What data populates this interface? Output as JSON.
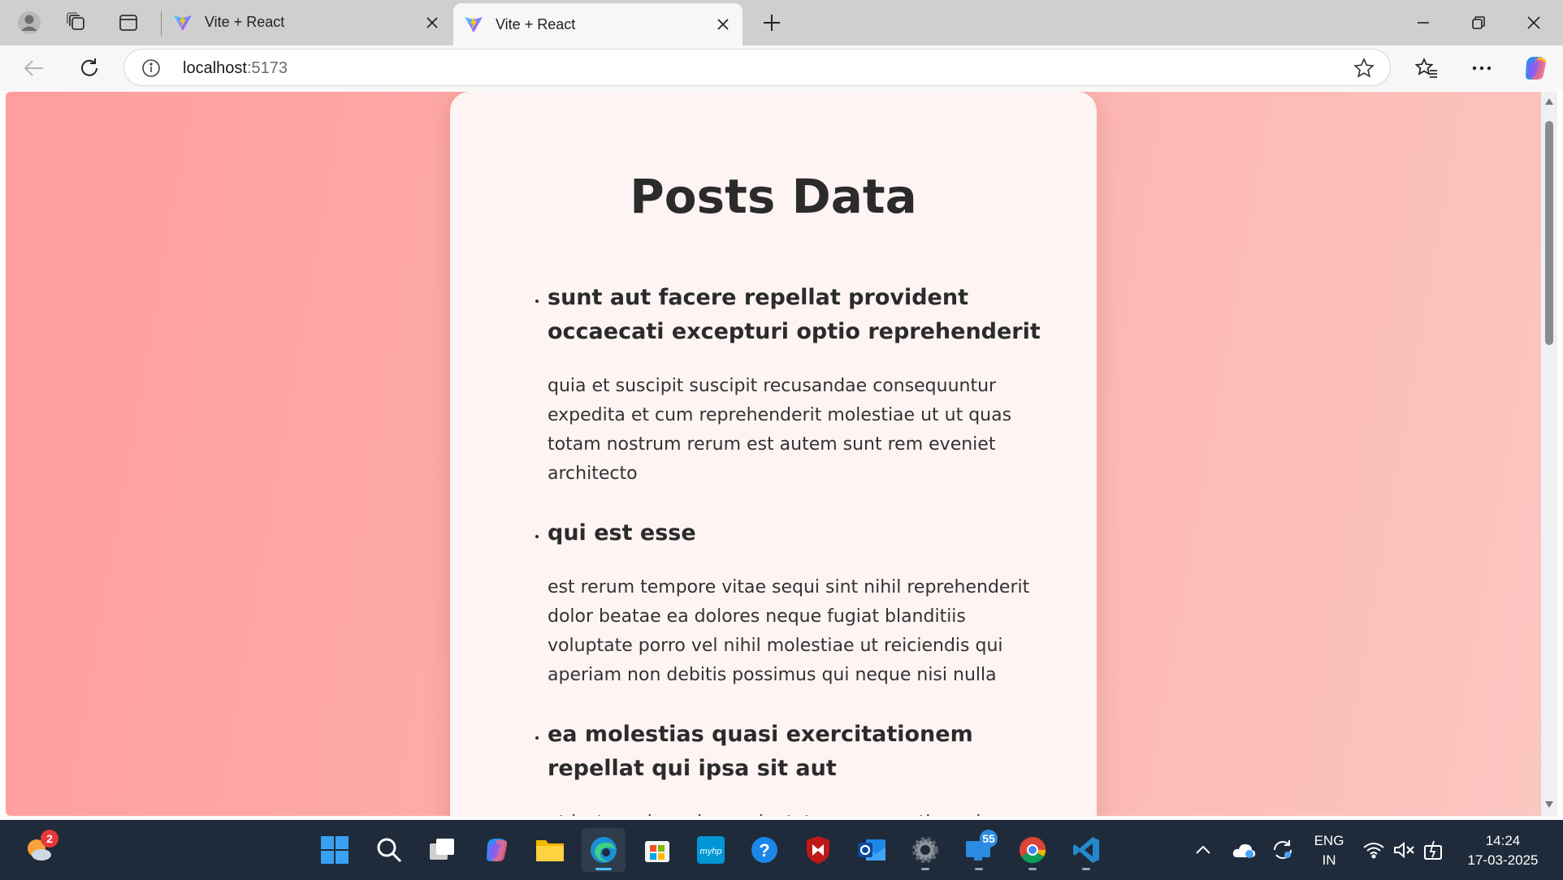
{
  "browser": {
    "tabs": [
      {
        "title": "Vite + React",
        "active": false
      },
      {
        "title": "Vite + React",
        "active": true
      }
    ],
    "address": {
      "host": "localhost",
      "port": ":5173"
    }
  },
  "page": {
    "heading": "Posts Data",
    "posts": [
      {
        "title": "sunt aut facere repellat provident occaecati excepturi optio reprehenderit",
        "body": "quia et suscipit suscipit recusandae consequuntur expedita et cum reprehenderit molestiae ut ut quas totam nostrum rerum est autem sunt rem eveniet architecto"
      },
      {
        "title": "qui est esse",
        "body": "est rerum tempore vitae sequi sint nihil reprehenderit dolor beatae ea dolores neque fugiat blanditiis voluptate porro vel nihil molestiae ut reiciendis qui aperiam non debitis possimus qui neque nisi nulla"
      },
      {
        "title": "ea molestias quasi exercitationem repellat qui ipsa sit aut",
        "body": "et iusto sed quo iure voluptatem occaecati omnis eligendi"
      }
    ]
  },
  "taskbar": {
    "weather_badge": "2",
    "outlook_badge": "55",
    "language": {
      "line1": "ENG",
      "line2": "IN"
    },
    "clock": {
      "time": "14:24",
      "date": "17-03-2025"
    }
  },
  "colors": {
    "page_gradient_start": "#fe9e9e",
    "page_gradient_end": "#fcc6c1",
    "card_background": "#fdf4f3",
    "taskbar": "#1f2b3a"
  }
}
